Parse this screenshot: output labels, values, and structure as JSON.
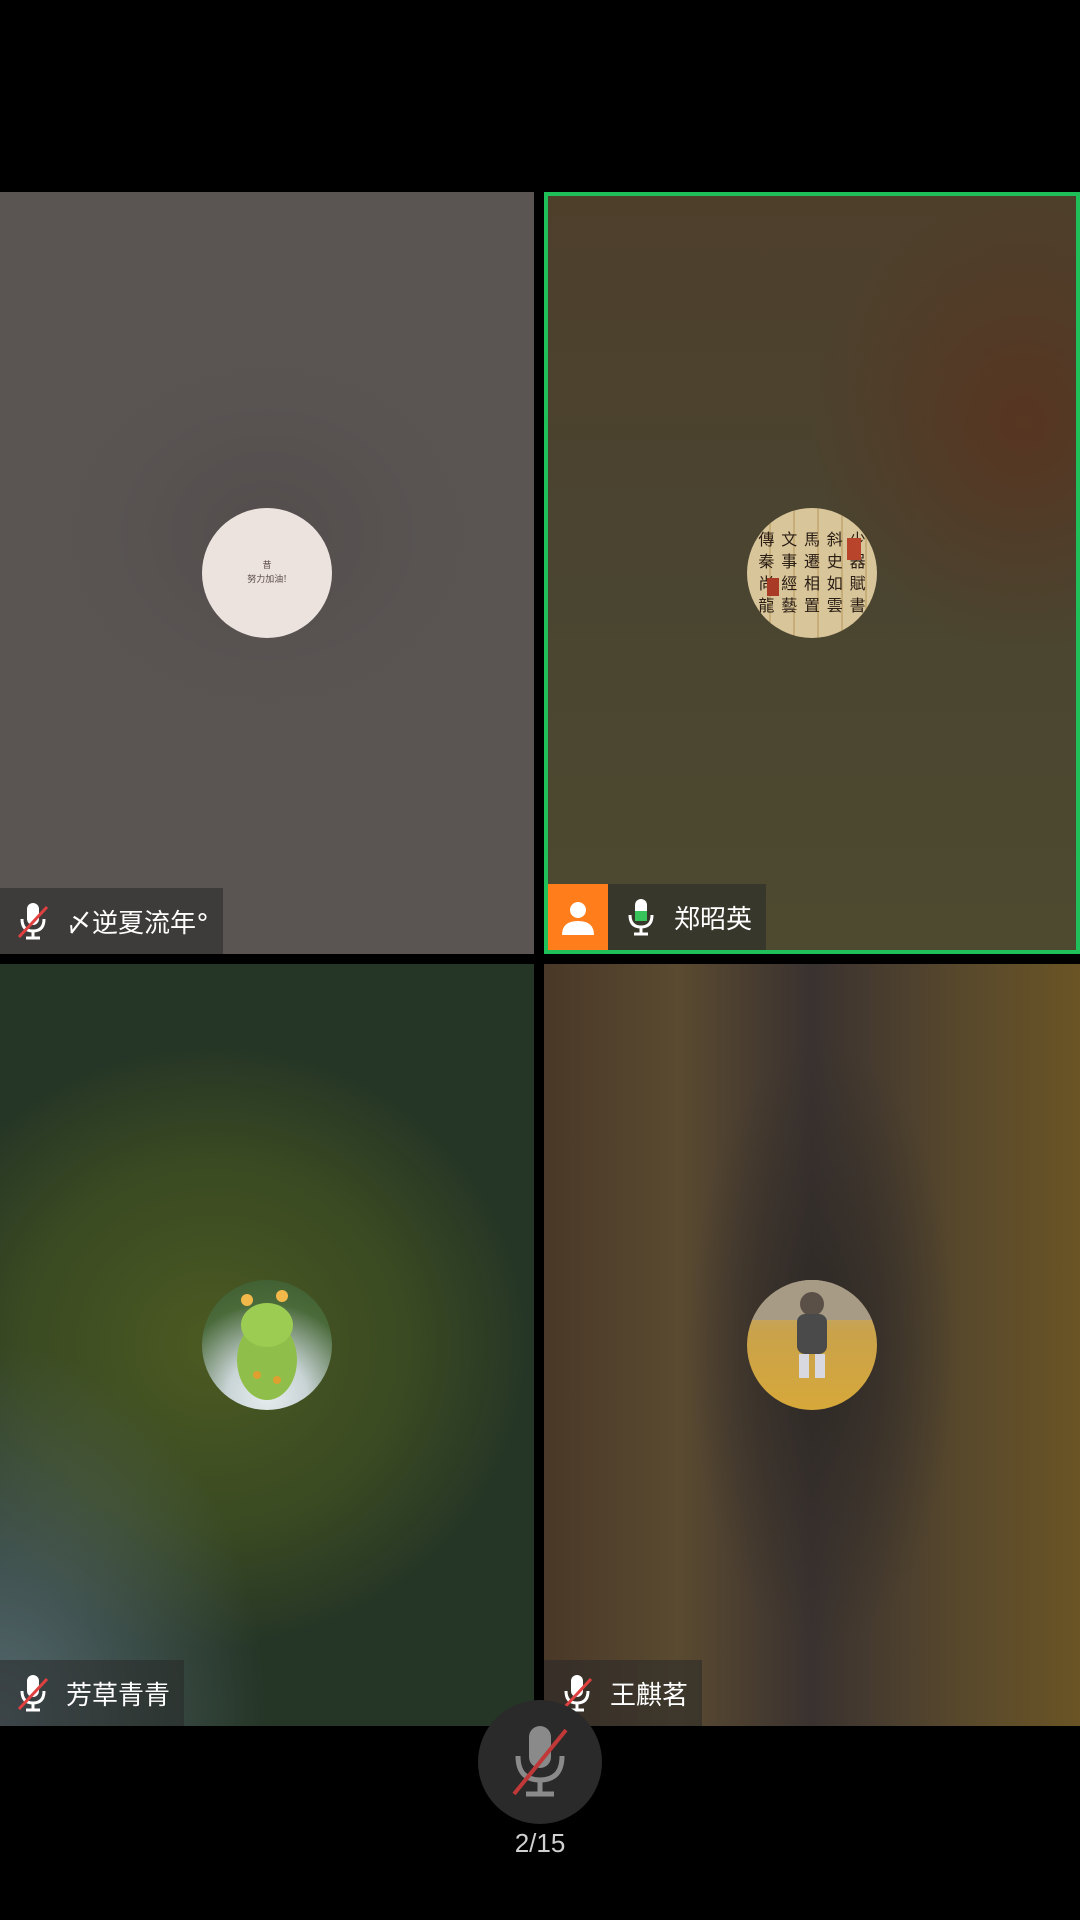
{
  "participants": [
    {
      "name": "〆逆夏流年°",
      "muted": true,
      "speaking": false,
      "avatar": "note-card-avatar",
      "avatar_text_line1": "昔",
      "avatar_text_line2": "努力加油!"
    },
    {
      "name": "郑昭英",
      "muted": false,
      "speaking": true,
      "host": true,
      "avatar": "calligraphy-avatar",
      "avatar_glyphs": [
        "傳",
        "文",
        "馬",
        "斜",
        "少",
        "秦",
        "事",
        "遷",
        "史",
        "器",
        "尚",
        "經",
        "相",
        "如",
        "賦",
        "龍",
        "藝",
        "置",
        "雲",
        "書"
      ]
    },
    {
      "name": "芳草青青",
      "muted": true,
      "speaking": false,
      "avatar": "green-toy-avatar"
    },
    {
      "name": "王麒茗",
      "muted": true,
      "speaking": false,
      "avatar": "child-photo-avatar"
    }
  ],
  "pagination": {
    "label": "2/15"
  },
  "colors": {
    "active_border": "#1fbf5a",
    "host_badge": "#ff7d1a",
    "mic_on": "#ffffff",
    "mic_off_slash": "#e04040"
  }
}
